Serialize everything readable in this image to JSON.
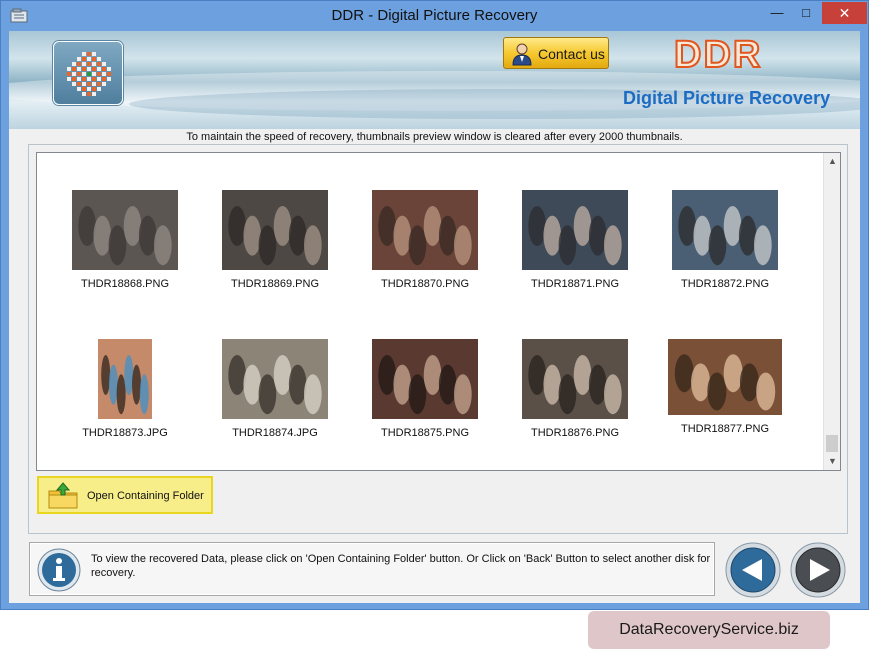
{
  "window": {
    "title": "DDR - Digital Picture Recovery",
    "minimize_glyph": "—",
    "maximize_glyph": "□",
    "close_glyph": "✕"
  },
  "header": {
    "contact_label": "Contact us",
    "brand": "DDR",
    "product": "Digital Picture Recovery"
  },
  "notice": "To maintain the speed of recovery, thumbnails preview window is cleared after every 2000 thumbnails.",
  "thumbnails": [
    {
      "file": "THDR18868.PNG",
      "colors": [
        "#5c5652",
        "#8e8782",
        "#3e3a38"
      ]
    },
    {
      "file": "THDR18869.PNG",
      "colors": [
        "#4d4844",
        "#9c8f85",
        "#2f2a28"
      ]
    },
    {
      "file": "THDR18870.PNG",
      "colors": [
        "#6a4438",
        "#b5917c",
        "#3b2a26"
      ]
    },
    {
      "file": "THDR18871.PNG",
      "colors": [
        "#3e4a58",
        "#b9a9a0",
        "#2d2d33"
      ]
    },
    {
      "file": "THDR18872.PNG",
      "colors": [
        "#4a5e74",
        "#c2c6c8",
        "#2c2e30"
      ]
    },
    {
      "file": "THDR18873.JPG",
      "colors": [
        "#c48a6a",
        "#4a8ec2",
        "#3a2a22"
      ]
    },
    {
      "file": "THDR18874.JPG",
      "colors": [
        "#8c8476",
        "#d6d0c4",
        "#3c3630"
      ]
    },
    {
      "file": "THDR18875.PNG",
      "colors": [
        "#5a3a30",
        "#c0a08c",
        "#241a16"
      ]
    },
    {
      "file": "THDR18876.PNG",
      "colors": [
        "#5a5048",
        "#c8b8a8",
        "#2a2420"
      ]
    },
    {
      "file": "THDR18877.PNG",
      "colors": [
        "#7a5036",
        "#dcb898",
        "#3a281c"
      ]
    }
  ],
  "actions": {
    "open_folder_label": "Open Containing Folder"
  },
  "info": {
    "message": "To view the recovered Data, please click on 'Open Containing Folder' button. Or Click on 'Back' Button to select another disk for recovery."
  },
  "watermark": "DataRecoveryService.biz",
  "colors": {
    "titlebar": "#6da0de",
    "close": "#c7413a",
    "accent_orange": "#e0561e",
    "product_blue": "#1c6cc4",
    "highlight_yellow": "#f7ee8a"
  },
  "icons": {
    "app": "app-icon",
    "logo": "ddr-logo-icon",
    "contact": "person-icon",
    "folder": "folder-up-icon",
    "info": "info-icon",
    "back": "back-arrow-icon",
    "next": "next-arrow-icon"
  }
}
